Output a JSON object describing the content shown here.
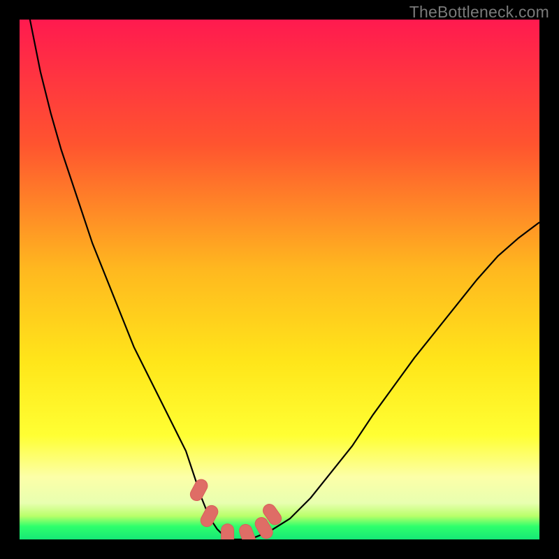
{
  "watermark": "TheBottleneck.com",
  "colors": {
    "frame": "#000000",
    "curve": "#000000",
    "marker_fill": "#df6d66",
    "marker_stroke": "#d85f59",
    "grad_top": "#ff1a4f",
    "grad_mid1": "#ff6a2e",
    "grad_mid2": "#ffd41a",
    "grad_yellow": "#ffff33",
    "grad_pale": "#fbffb8",
    "grad_lime": "#b6ff66",
    "grad_green": "#2eff6c",
    "grad_green2": "#16e876"
  },
  "chart_data": {
    "type": "line",
    "title": "",
    "xlabel": "",
    "ylabel": "",
    "xlim": [
      0,
      100
    ],
    "ylim": [
      0,
      100
    ],
    "x": [
      0,
      2,
      4,
      6,
      8,
      10,
      12,
      14,
      16,
      18,
      20,
      22,
      24,
      26,
      28,
      30,
      32,
      33,
      34,
      35,
      36,
      37,
      38,
      39,
      40,
      41,
      42,
      43,
      45,
      48,
      52,
      56,
      60,
      64,
      68,
      72,
      76,
      80,
      84,
      88,
      92,
      96,
      100
    ],
    "values": [
      120,
      100,
      90,
      82,
      75,
      69,
      63,
      57,
      52,
      47,
      42,
      37,
      33,
      29,
      25,
      21,
      17,
      14,
      11,
      8,
      5.5,
      3.5,
      2,
      1,
      0.4,
      0,
      0,
      0,
      0.3,
      1.5,
      4,
      8,
      13,
      18,
      24,
      29.5,
      35,
      40,
      45,
      50,
      54.5,
      58,
      61
    ],
    "markers": {
      "x": [
        34.5,
        36.5,
        40,
        44,
        47,
        48.6
      ],
      "y": [
        9.5,
        4.5,
        0.3,
        0.3,
        2.2,
        4.8
      ],
      "angle_deg": [
        118,
        118,
        90,
        70,
        60,
        55
      ]
    }
  }
}
